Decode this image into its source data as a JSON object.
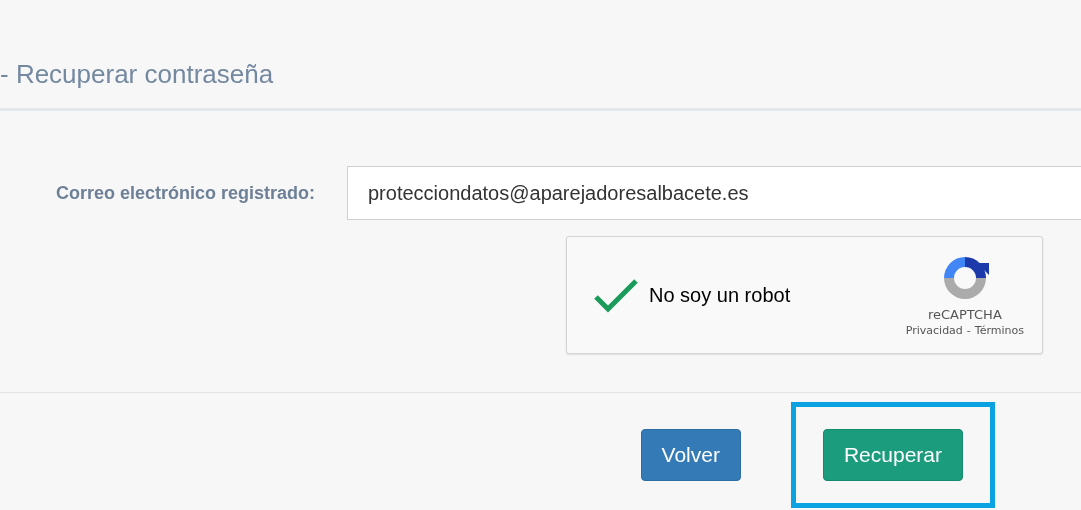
{
  "title": "- Recuperar contraseña",
  "form": {
    "label": "Correo electrónico registrado:",
    "value": "protecciondatos@aparejadoresalbacete.es"
  },
  "captcha": {
    "checked": true,
    "label": "No soy un robot",
    "brand": "reCAPTCHA",
    "privacy": "Privacidad",
    "separator": "-",
    "terms": "Términos"
  },
  "buttons": [
    {
      "label": "Volver",
      "kind": "secondary",
      "highlighted": false
    },
    {
      "label": "Recuperar",
      "kind": "primary",
      "highlighted": true
    }
  ]
}
